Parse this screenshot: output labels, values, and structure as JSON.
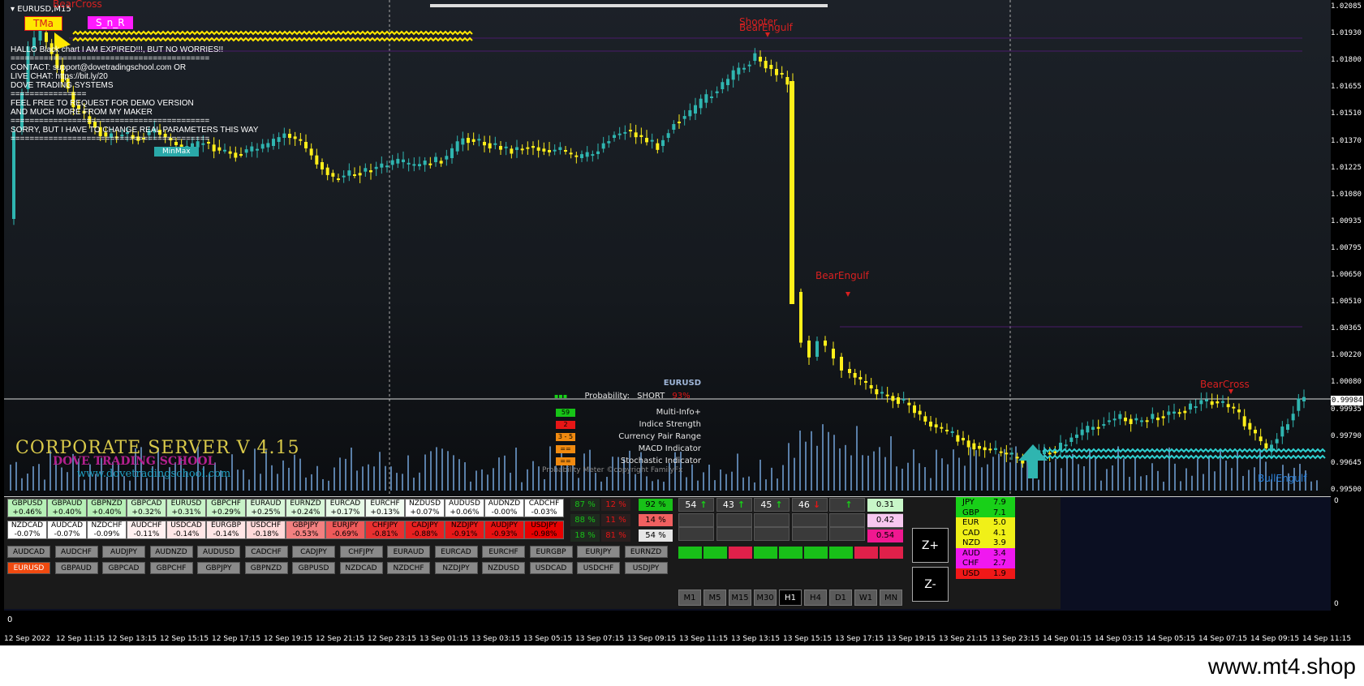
{
  "chart": {
    "symbol": "EURUSD,M15",
    "current_price": "0.99984",
    "price_labels": [
      "1.02085",
      "1.01930",
      "1.01800",
      "1.01655",
      "1.01510",
      "1.01370",
      "1.01225",
      "1.01080",
      "1.00935",
      "1.00795",
      "1.00650",
      "1.00510",
      "1.00365",
      "1.00220",
      "1.00080",
      "0.99935",
      "0.99790",
      "0.99645",
      "0.99500"
    ],
    "panel_axis": {
      "top": "0",
      "bottom": "0"
    },
    "time_labels": [
      "12 Sep 2022",
      "12 Sep 11:15",
      "12 Sep 13:15",
      "12 Sep 15:15",
      "12 Sep 17:15",
      "12 Sep 19:15",
      "12 Sep 21:15",
      "12 Sep 23:15",
      "13 Sep 01:15",
      "13 Sep 03:15",
      "13 Sep 05:15",
      "13 Sep 07:15",
      "13 Sep 09:15",
      "13 Sep 11:15",
      "13 Sep 13:15",
      "13 Sep 15:15",
      "13 Sep 17:15",
      "13 Sep 19:15",
      "13 Sep 21:15",
      "13 Sep 23:15",
      "14 Sep 01:15",
      "14 Sep 03:15",
      "14 Sep 05:15",
      "14 Sep 07:15",
      "14 Sep 09:15",
      "14 Sep 11:15"
    ],
    "bottom_panel_value": "0"
  },
  "tags": {
    "tma": "TMa",
    "snr": "S_n_R",
    "bearcross_top": "BearCross",
    "minmax": "MinMax"
  },
  "info_lines": [
    "HALLO Black chart I AM EXPIRED!!!, BUT NO WORRIES!!",
    "==========================================",
    "CONTACT: support@dovetradingschool.com OR",
    "LIVE CHAT: https://bit.ly/20",
    "DOVE TRADING SYSTEMS",
    "================",
    "FEEL FREE TO REQUEST FOR DEMO VERSION",
    "AND MUCH MORE FROM MY MAKER",
    "==========================================",
    "SORRY, BUT I HAVE TO CHANGE REAL PARAMETERS THIS WAY",
    "=========================================="
  ],
  "signals": {
    "shooter": "Shooter",
    "bearengulf1": "BearEngulf",
    "bearengulf2": "BearEngulf",
    "bearcross": "BearCross",
    "bullengulf": "BullEngulf"
  },
  "branding": {
    "title": "CORPORATE SERVER V 4.15",
    "school": "DOVE TRADING SCHOOL",
    "url": "www.dovetradingschool.com"
  },
  "prob_meter": {
    "symbol": "EURUSD",
    "probability_label": "Probability:",
    "direction": "SHORT",
    "percent": "93%",
    "rows": [
      {
        "box": "59",
        "color": "#17c417",
        "label": "Multi-Info+"
      },
      {
        "box": "2",
        "color": "#e61616",
        "label": "Indice Strength"
      },
      {
        "box": "3 - 5",
        "color": "#f08a10",
        "label": "Currency Pair Range"
      },
      {
        "box": "==",
        "color": "#f08a10",
        "label": "MACD Indicator"
      },
      {
        "box": "==",
        "color": "#f08a10",
        "label": "Stochastic Indicator"
      }
    ],
    "footer": "Probability Meter ©copyright FamilyFx"
  },
  "pairs_row1": [
    {
      "pair": "GBPUSD",
      "pct": "+0.46%",
      "color": "#b6f0b6"
    },
    {
      "pair": "GBPAUD",
      "pct": "+0.40%",
      "color": "#b6f0b6"
    },
    {
      "pair": "GBPNZD",
      "pct": "+0.40%",
      "color": "#b6f0b6"
    },
    {
      "pair": "GBPCAD",
      "pct": "+0.32%",
      "color": "#c8f3c8"
    },
    {
      "pair": "EURUSD",
      "pct": "+0.31%",
      "color": "#c8f3c8"
    },
    {
      "pair": "GBPCHF",
      "pct": "+0.29%",
      "color": "#c8f3c8"
    },
    {
      "pair": "EURAUD",
      "pct": "+0.25%",
      "color": "#d8f6d8"
    },
    {
      "pair": "EURNZD",
      "pct": "+0.24%",
      "color": "#d8f6d8"
    },
    {
      "pair": "EURCAD",
      "pct": "+0.17%",
      "color": "#e6f9e6"
    },
    {
      "pair": "EURCHF",
      "pct": "+0.13%",
      "color": "#f0fbf0"
    },
    {
      "pair": "NZDUSD",
      "pct": "+0.07%",
      "color": "#ffffff"
    },
    {
      "pair": "AUDUSD",
      "pct": "+0.06%",
      "color": "#ffffff"
    },
    {
      "pair": "AUDNZD",
      "pct": "-0.00%",
      "color": "#ffffff"
    },
    {
      "pair": "CADCHF",
      "pct": "-0.03%",
      "color": "#ffffff"
    }
  ],
  "pairs_row2": [
    {
      "pair": "NZDCAD",
      "pct": "-0.07%",
      "color": "#ffffff"
    },
    {
      "pair": "AUDCAD",
      "pct": "-0.07%",
      "color": "#ffffff"
    },
    {
      "pair": "NZDCHF",
      "pct": "-0.09%",
      "color": "#ffffff"
    },
    {
      "pair": "AUDCHF",
      "pct": "-0.11%",
      "color": "#fff0f0"
    },
    {
      "pair": "USDCAD",
      "pct": "-0.14%",
      "color": "#ffe6e6"
    },
    {
      "pair": "EURGBP",
      "pct": "-0.14%",
      "color": "#ffe6e6"
    },
    {
      "pair": "USDCHF",
      "pct": "-0.18%",
      "color": "#ffd9d9"
    },
    {
      "pair": "GBPJPY",
      "pct": "-0.53%",
      "color": "#f28080"
    },
    {
      "pair": "EURJPY",
      "pct": "-0.69%",
      "color": "#ee5a5a"
    },
    {
      "pair": "CHFJPY",
      "pct": "-0.81%",
      "color": "#e83030"
    },
    {
      "pair": "CADJPY",
      "pct": "-0.88%",
      "color": "#e82020"
    },
    {
      "pair": "NZDJPY",
      "pct": "-0.91%",
      "color": "#e81818"
    },
    {
      "pair": "AUDJPY",
      "pct": "-0.93%",
      "color": "#e81010"
    },
    {
      "pair": "USDJPY",
      "pct": "-0.98%",
      "color": "#e80000"
    }
  ],
  "buttons_row1": [
    "AUDCAD",
    "AUDCHF",
    "AUDJPY",
    "AUDNZD",
    "AUDUSD",
    "CADCHF",
    "CADJPY",
    "CHFJPY",
    "EURAUD",
    "EURCAD",
    "EURCHF",
    "EURGBP",
    "EURJPY",
    "EURNZD"
  ],
  "buttons_row2": [
    "EURUSD",
    "GBPAUD",
    "GBPCAD",
    "GBPCHF",
    "GBPJPY",
    "GBPNZD",
    "GBPUSD",
    "NZDCAD",
    "NZDCHF",
    "NZDJPY",
    "NZDUSD",
    "USDCAD",
    "USDCHF",
    "USDJPY"
  ],
  "active_button": "EURUSD",
  "pct_rows": [
    {
      "a": "87 %",
      "b": "12 %",
      "c": "92 %",
      "c_color": "#18c018"
    },
    {
      "a": "88 %",
      "b": "11 %",
      "c": "14 %",
      "c_color": "#f06060"
    },
    {
      "a": "18 %",
      "b": "81 %",
      "c": "54 %",
      "c_color": "#e6e6e6"
    }
  ],
  "arrow_cells": [
    {
      "num": "54",
      "dir": "up",
      "color": "#18d018"
    },
    {
      "num": "43",
      "dir": "up",
      "color": "#18d018"
    },
    {
      "num": "45",
      "dir": "up",
      "color": "#18d018"
    },
    {
      "num": "46",
      "dir": "down",
      "color": "#e61616"
    },
    {
      "num": "",
      "dir": "up",
      "color": "#18d018"
    }
  ],
  "arrow_glyphs": {
    "up": "↑",
    "down": "↓"
  },
  "bar_colors": [
    "#18c018",
    "#18c018",
    "#e0204a",
    "#18c018",
    "#18c018",
    "#18c018",
    "#18c018",
    "#e0204a",
    "#e0204a"
  ],
  "values": [
    {
      "v": "0.31",
      "color": "#c8f7c8"
    },
    {
      "v": "0.42",
      "color": "#f7c8f0"
    },
    {
      "v": "0.54",
      "color": "#f01890"
    }
  ],
  "timeframes": [
    "M1",
    "M5",
    "M15",
    "M30",
    "H1",
    "H4",
    "D1",
    "W1",
    "MN"
  ],
  "active_timeframe": "H1",
  "zoom": {
    "in": "Z+",
    "out": "Z-"
  },
  "strength": [
    {
      "ccy": "JPY",
      "val": "7.9",
      "color": "#18d018"
    },
    {
      "ccy": "GBP",
      "val": "7.1",
      "color": "#18d018"
    },
    {
      "ccy": "EUR",
      "val": "5.0",
      "color": "#f0f018"
    },
    {
      "ccy": "CAD",
      "val": "4.1",
      "color": "#f0f018"
    },
    {
      "ccy": "NZD",
      "val": "3.9",
      "color": "#f0f018"
    },
    {
      "ccy": "AUD",
      "val": "3.4",
      "color": "#f018f0"
    },
    {
      "ccy": "CHF",
      "val": "2.7",
      "color": "#f018f0"
    },
    {
      "ccy": "USD",
      "val": "1.9",
      "color": "#f01818"
    }
  ],
  "footer": {
    "url": "www.mt4.shop"
  }
}
